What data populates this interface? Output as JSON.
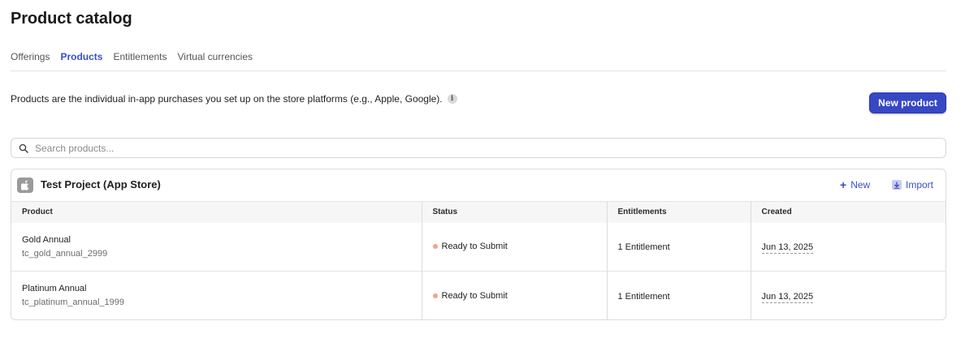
{
  "page": {
    "title": "Product catalog"
  },
  "tabs": [
    {
      "label": "Offerings",
      "active": false
    },
    {
      "label": "Products",
      "active": true
    },
    {
      "label": "Entitlements",
      "active": false
    },
    {
      "label": "Virtual currencies",
      "active": false
    }
  ],
  "description": {
    "text": "Products are the individual in-app purchases you set up on the store platforms (e.g., Apple, Google).",
    "info_icon": "i"
  },
  "new_product_button": {
    "label": "New product"
  },
  "search": {
    "placeholder": "Search products...",
    "value": ""
  },
  "store_card": {
    "title": "Test Project (App Store)",
    "icon": "apple-icon",
    "actions": {
      "new_label": "New",
      "import_label": "Import"
    },
    "columns": [
      "Product",
      "Status",
      "Entitlements",
      "Created"
    ],
    "rows": [
      {
        "product_name": "Gold Annual",
        "product_id": "tc_gold_annual_2999",
        "status": "Ready to Submit",
        "entitlements": "1 Entitlement",
        "created": "Jun 13, 2025"
      },
      {
        "product_name": "Platinum Annual",
        "product_id": "tc_platinum_annual_1999",
        "status": "Ready to Submit",
        "entitlements": "1 Entitlement",
        "created": "Jun 13, 2025"
      }
    ]
  },
  "colors": {
    "accent": "#3a4fc5",
    "button_bg": "#3847c4",
    "status_dot": "#f5a28e"
  }
}
